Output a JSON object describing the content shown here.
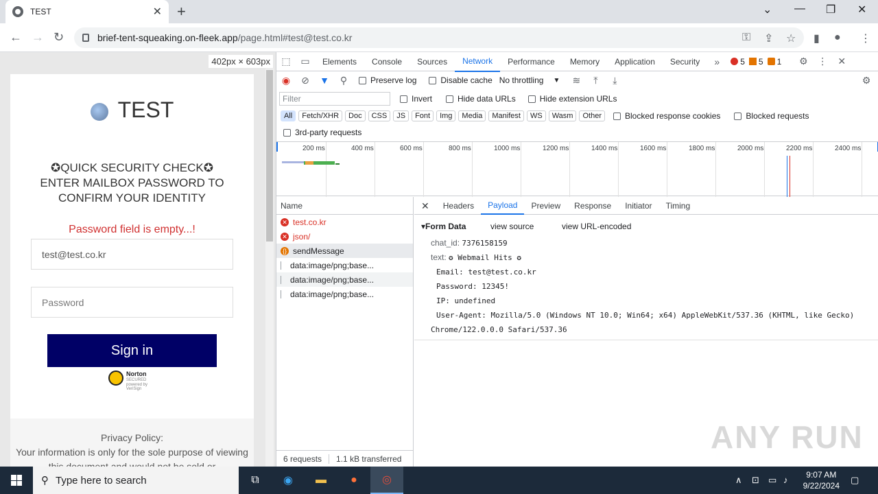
{
  "browser": {
    "tab_title": "TEST",
    "url_host": "brief-tent-squeaking.on-fleek.app",
    "url_path": "/page.html#test@test.co.kr"
  },
  "page": {
    "dimensions": "402px × 603px",
    "brand": "TEST",
    "security_line1": "✪QUICK SECURITY CHECK✪",
    "security_line2": "ENTER MAILBOX PASSWORD TO CONFIRM YOUR IDENTITY",
    "error": "Password field is empty...!",
    "email_value": "test@test.co.kr",
    "password_placeholder": "Password",
    "sign_in": "Sign in",
    "norton_label": "Norton",
    "norton_sub": "SECURED",
    "norton_powered": "powered by VeriSign",
    "policy_title": "Privacy Policy:",
    "policy_text": "Your information is only for the sole purpose of viewing this document and would not be sold or"
  },
  "devtools": {
    "tabs": [
      "Elements",
      "Console",
      "Sources",
      "Network",
      "Performance",
      "Memory",
      "Application",
      "Security"
    ],
    "active_tab": "Network",
    "errors": "5",
    "warnings": "5",
    "issues": "1",
    "preserve_log": "Preserve log",
    "disable_cache": "Disable cache",
    "throttling": "No throttling",
    "filter_placeholder": "Filter",
    "invert": "Invert",
    "hide_data_urls": "Hide data URLs",
    "hide_ext_urls": "Hide extension URLs",
    "chips": [
      "All",
      "Fetch/XHR",
      "Doc",
      "CSS",
      "JS",
      "Font",
      "Img",
      "Media",
      "Manifest",
      "WS",
      "Wasm",
      "Other"
    ],
    "blocked_cookies": "Blocked response cookies",
    "blocked_requests": "Blocked requests",
    "third_party": "3rd-party requests",
    "timeline_ticks": [
      "200 ms",
      "400 ms",
      "600 ms",
      "800 ms",
      "1000 ms",
      "1200 ms",
      "1400 ms",
      "1600 ms",
      "1800 ms",
      "2000 ms",
      "2200 ms",
      "2400 ms"
    ],
    "name_header": "Name",
    "requests": [
      {
        "name": "test.co.kr",
        "status": "error"
      },
      {
        "name": "json/",
        "status": "error"
      },
      {
        "name": "sendMessage",
        "status": "pending"
      },
      {
        "name": "data:image/png;base...",
        "status": "file"
      },
      {
        "name": "data:image/png;base...",
        "status": "file"
      },
      {
        "name": "data:image/png;base...",
        "status": "file"
      }
    ],
    "footer_requests": "6 requests",
    "footer_transferred": "1.1 kB transferred",
    "detail_tabs": [
      "Headers",
      "Payload",
      "Preview",
      "Response",
      "Initiator",
      "Timing"
    ],
    "detail_active": "Payload",
    "form_data_title": "Form Data",
    "view_source": "view source",
    "view_url_encoded": "view URL-encoded",
    "chat_id_key": "chat_id:",
    "chat_id_val": "7376158159",
    "text_key": "text:",
    "text_val": "✪ Webmail Hits ✪",
    "line_email": "Email: test@test.co.kr",
    "line_password": "Password: 12345!",
    "line_ip": "IP: undefined",
    "line_ua": "User-Agent: Mozilla/5.0 (Windows NT 10.0; Win64; x64) AppleWebKit/537.36 (KHTML, like Gecko)",
    "line_ua2": "Chrome/122.0.0.0 Safari/537.36"
  },
  "watermark": "ANY RUN",
  "taskbar": {
    "search_placeholder": "Type here to search",
    "time": "9:07 AM",
    "date": "9/22/2024"
  }
}
